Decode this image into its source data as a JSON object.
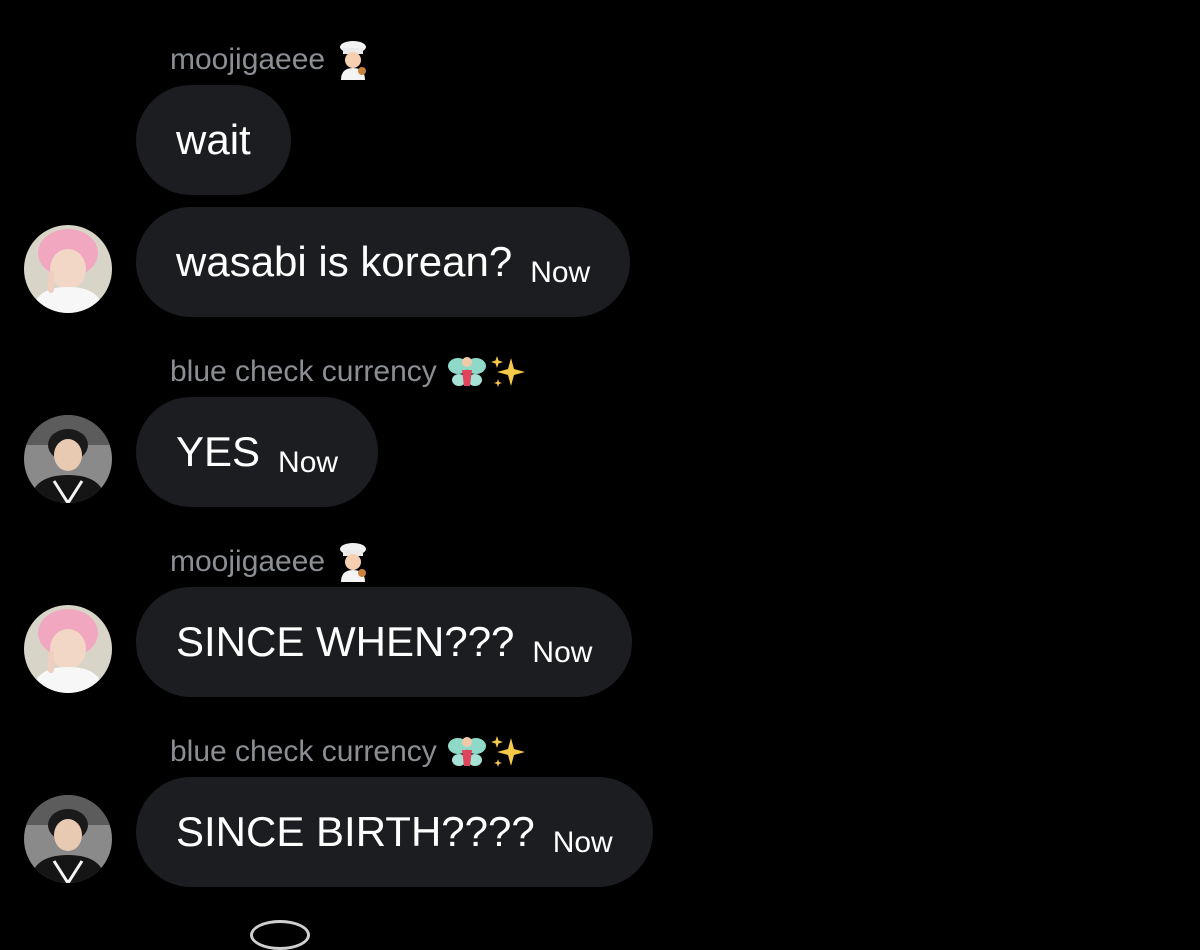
{
  "conversation": {
    "messages": [
      {
        "sender": "moojigaeee",
        "sender_emoji": [
          "cook-emoji"
        ],
        "text": "wait",
        "time": "",
        "avatar": ""
      },
      {
        "sender": "",
        "sender_emoji": [],
        "text": "wasabi is korean?",
        "time": "Now",
        "avatar": "pink-haired-user-avatar"
      },
      {
        "sender": "blue check currency",
        "sender_emoji": [
          "fairy-emoji",
          "sparkles-emoji"
        ],
        "text": "YES",
        "time": "Now",
        "avatar": "dark-haired-user-avatar"
      },
      {
        "sender": "moojigaeee",
        "sender_emoji": [
          "cook-emoji"
        ],
        "text": "SINCE WHEN???",
        "time": "Now",
        "avatar": "pink-haired-user-avatar"
      },
      {
        "sender": "blue check currency",
        "sender_emoji": [
          "fairy-emoji",
          "sparkles-emoji"
        ],
        "text": "SINCE BIRTH????",
        "time": "Now",
        "avatar": "dark-haired-user-avatar"
      }
    ]
  },
  "colors": {
    "background": "#000000",
    "bubble": "#1c1d20",
    "sender_name": "#8b8f94",
    "message_text": "#ffffff"
  }
}
